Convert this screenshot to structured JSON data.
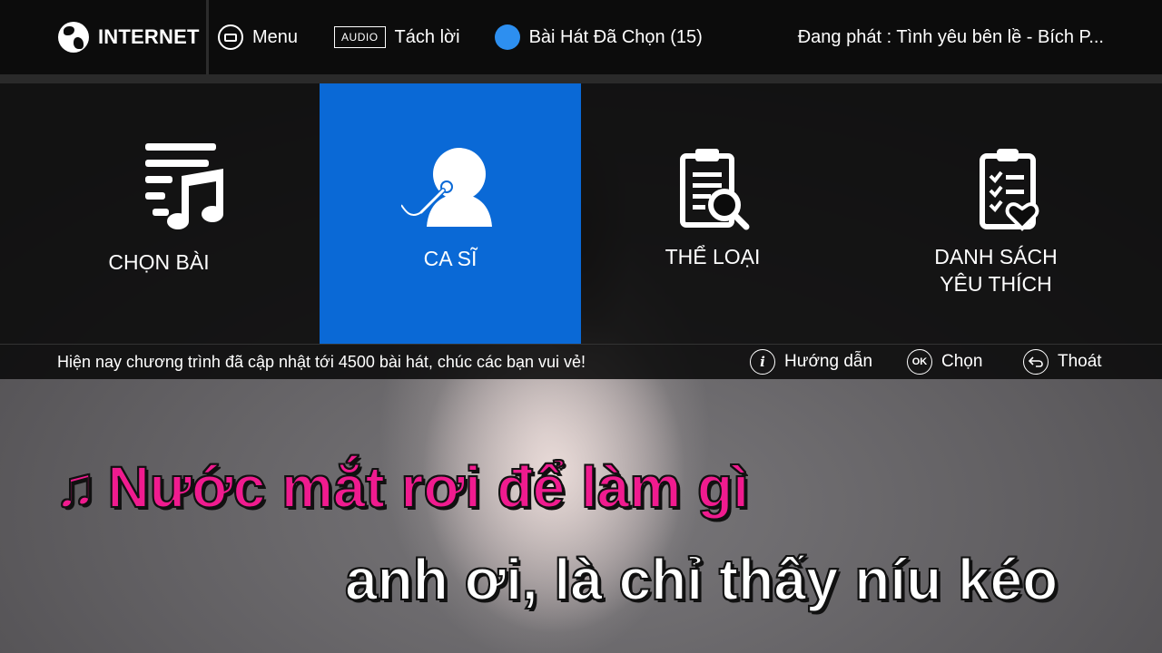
{
  "topbar": {
    "brand": "INTERNET",
    "menu_label": "Menu",
    "audio_badge": "AUDIO",
    "audio_label": "Tách lời",
    "selected_songs": "Bài Hát Đã Chọn (15)",
    "now_playing": "Đang phát : Tình yêu bên lề - Bích P..."
  },
  "tiles": [
    {
      "label_line1": "CHỌN BÀI",
      "label_line2": "",
      "icon": "music-list-icon",
      "active": false
    },
    {
      "label_line1": "CA SĨ",
      "label_line2": "",
      "icon": "singer-mic-icon",
      "active": true
    },
    {
      "label_line1": "THỂ LOẠI",
      "label_line2": "",
      "icon": "clipboard-search-icon",
      "active": false
    },
    {
      "label_line1": "DANH SÁCH",
      "label_line2": "YÊU THÍCH",
      "icon": "clipboard-heart-icon",
      "active": false
    }
  ],
  "info_bar": {
    "message": "Hiện nay chương trình đã cập nhật tới 4500 bài hát, chúc các bạn vui vẻ!",
    "hint_guide": "Hướng dẫn",
    "hint_guide_key": "i",
    "hint_select": "Chọn",
    "hint_select_key": "OK",
    "hint_exit": "Thoát"
  },
  "lyrics": {
    "note": "♫",
    "line1": "Nước mắt rơi để làm gì",
    "line2": "anh ơi, là chỉ thấy níu kéo"
  },
  "colors": {
    "accent_blue": "#0a69d6",
    "selected_dot": "#2d8ff0",
    "lyric_highlight": "#f01b8f"
  }
}
